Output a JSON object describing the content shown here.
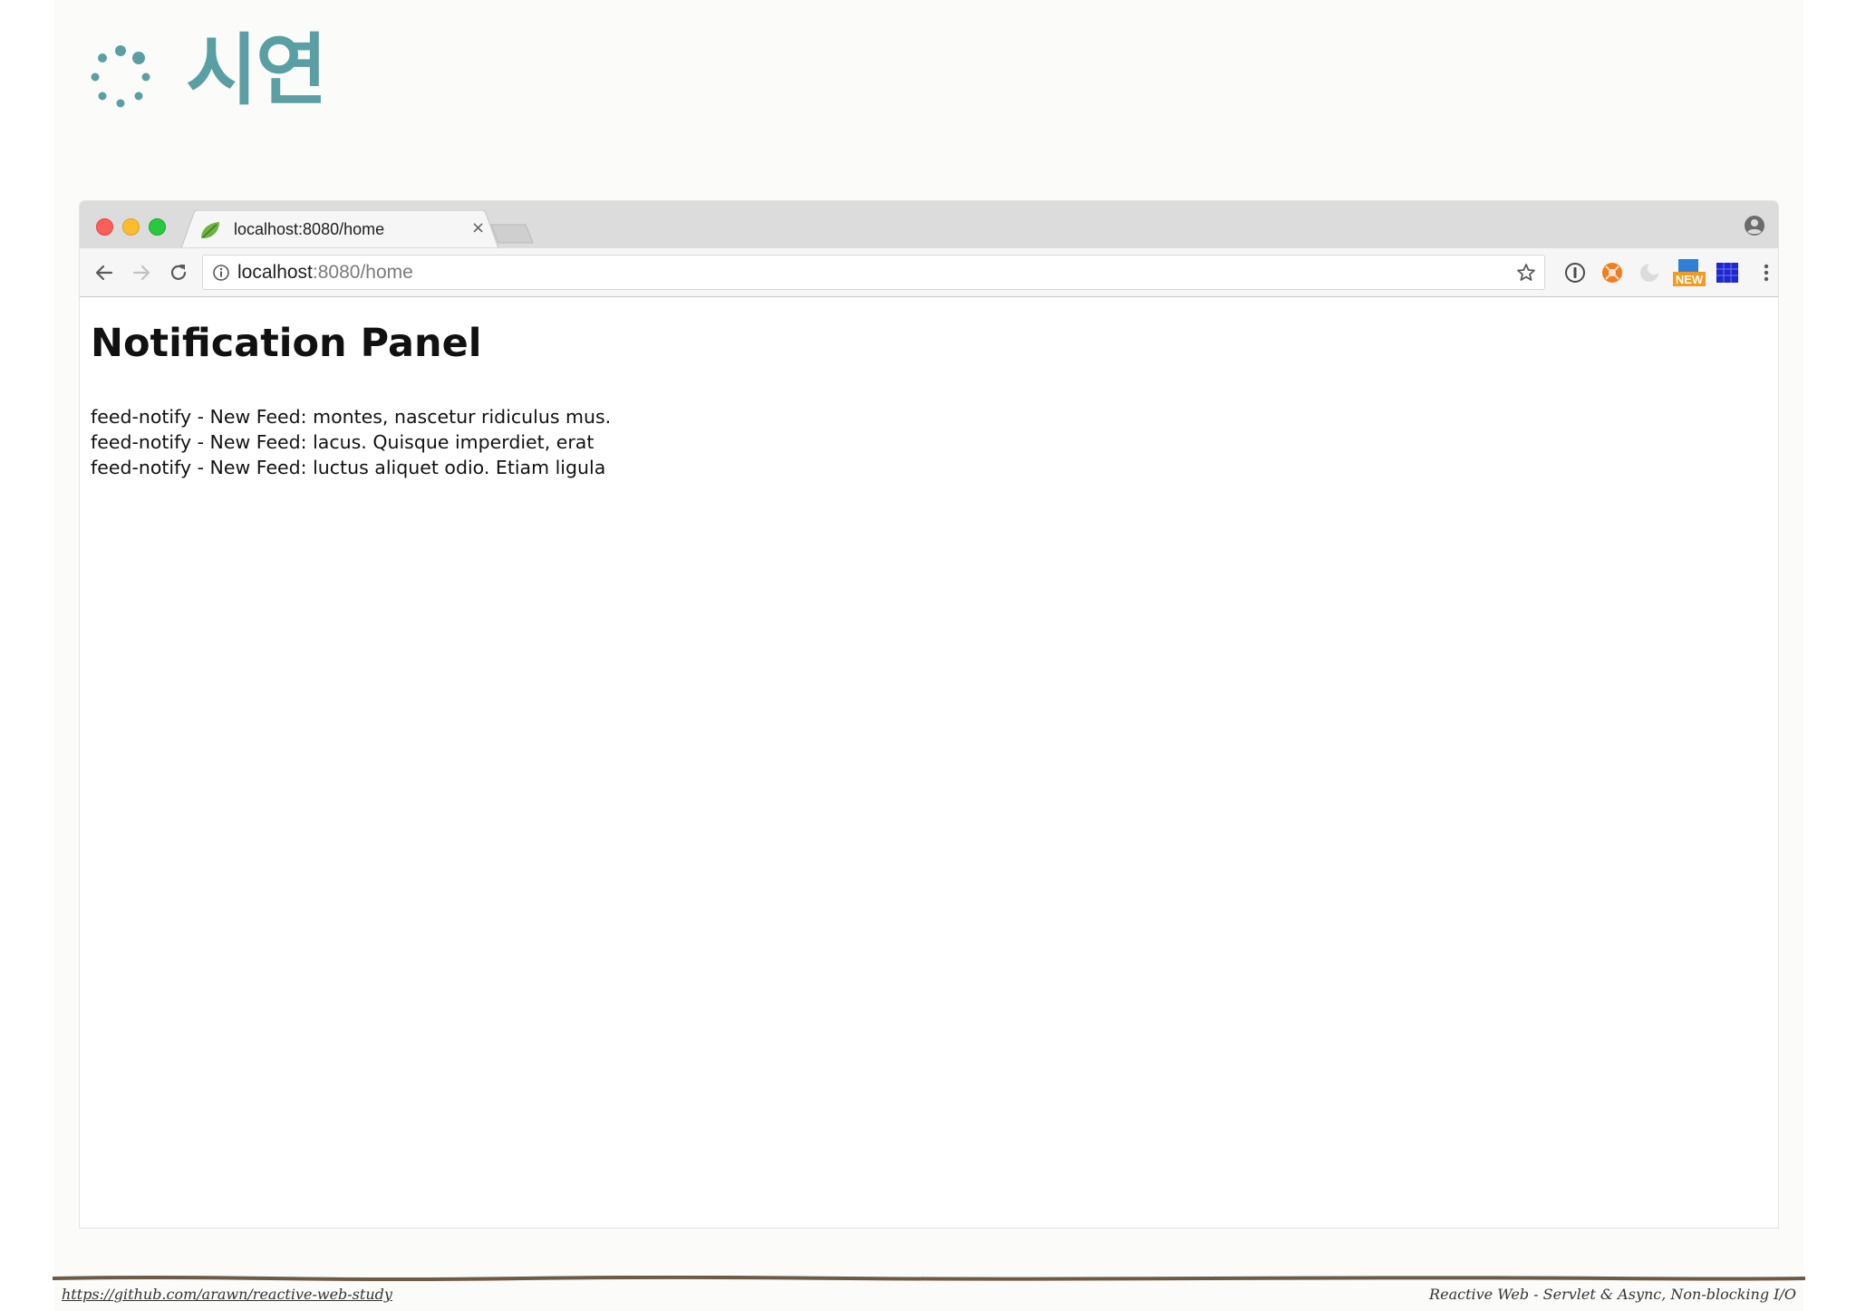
{
  "slide": {
    "title": "시연",
    "footer_link": "https://github.com/arawn/reactive-web-study",
    "footer_caption": "Reactive Web - Servlet & Async, Non-blocking I/O"
  },
  "browser": {
    "tab_title": "localhost:8080/home",
    "tab_close": "×",
    "address": {
      "host": "localhost",
      "path": ":8080/home"
    }
  },
  "page": {
    "heading": "Notification Panel",
    "feeds": [
      "feed-notify - New Feed: montes, nascetur ridiculus mus.",
      "feed-notify - New Feed: lacus. Quisque imperdiet, erat",
      "feed-notify - New Feed: luctus aliquet odio. Etiam ligula"
    ]
  },
  "icons": {
    "logo": "loading-spinner-icon",
    "favicon": "spring-leaf-icon",
    "back": "arrow-left-icon",
    "forward": "arrow-right-icon",
    "reload": "reload-icon",
    "info": "info-circle-icon",
    "bookmark": "star-icon",
    "profile": "user-circle-icon",
    "menu": "vertical-dots-icon"
  },
  "colors": {
    "accent": "#5a9fa3",
    "close": "#fc5f57",
    "minimize": "#fdbc2e",
    "maximize": "#29c840"
  }
}
